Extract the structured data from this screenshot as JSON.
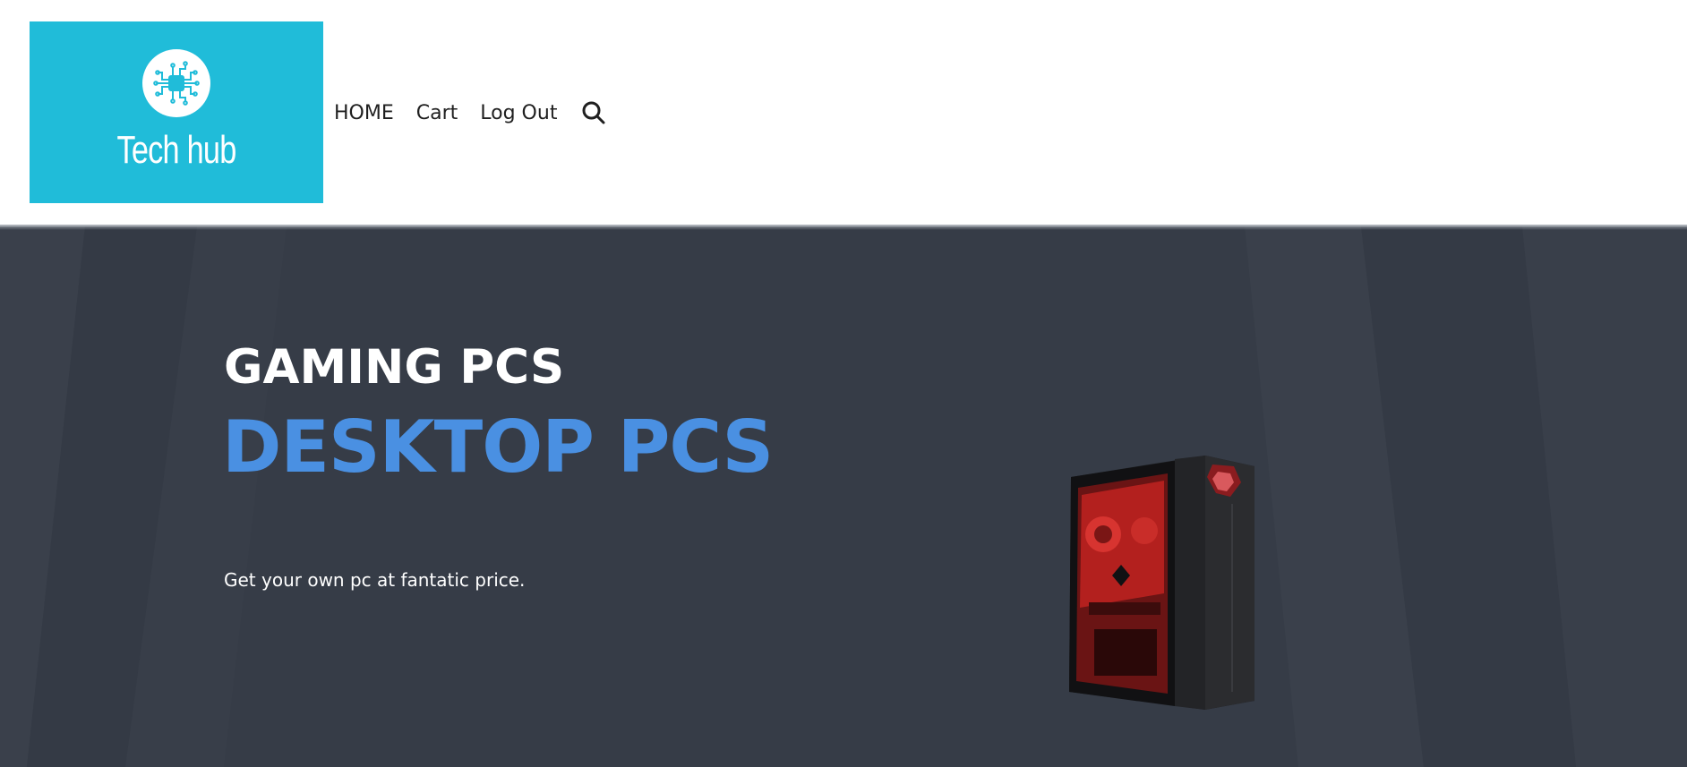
{
  "brand": {
    "name": "Tech hub",
    "logo_icon": "circuit-chip-icon",
    "accent": "#20bcd9"
  },
  "nav": {
    "items": [
      {
        "label": "HOME"
      },
      {
        "label": "Cart"
      },
      {
        "label": "Log Out"
      }
    ],
    "search_icon": "search-icon"
  },
  "hero": {
    "title_line1": "GAMING PCS",
    "title_line2": "DESKTOP PCS",
    "subtitle": "Get your own pc at fantatic price.",
    "image_icon": "desktop-pc-tower-icon",
    "background_color": "#363c47",
    "highlight_color": "#4a90e2"
  }
}
